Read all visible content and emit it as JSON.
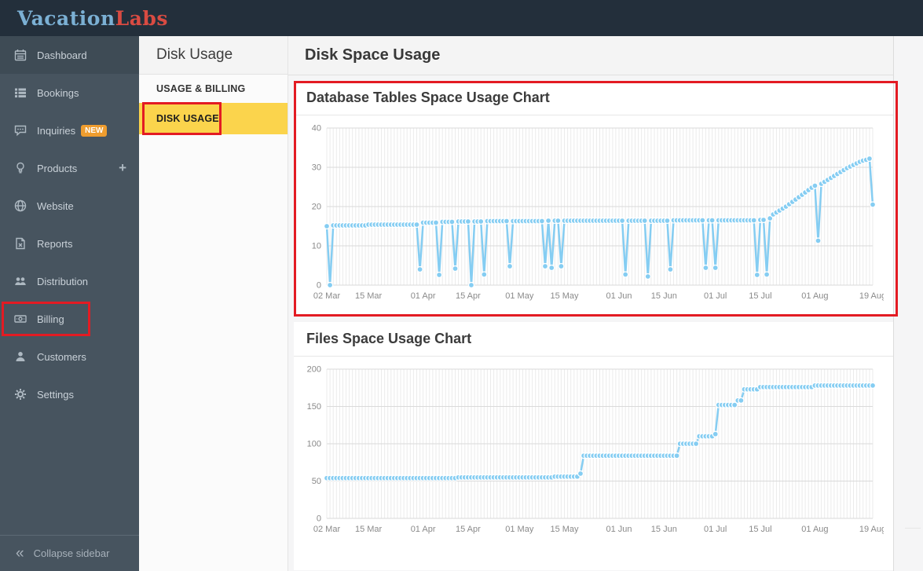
{
  "topbar": {
    "logo_part1": "Vacation",
    "logo_part2": "Labs"
  },
  "sidebar": {
    "items": [
      {
        "label": "Dashboard",
        "icon": "calendar-icon",
        "active": true
      },
      {
        "label": "Bookings",
        "icon": "list-icon",
        "active": false
      },
      {
        "label": "Inquiries",
        "icon": "comment-icon",
        "active": false,
        "badge": "NEW"
      },
      {
        "label": "Products",
        "icon": "lightbulb-icon",
        "active": false,
        "action": "+"
      },
      {
        "label": "Website",
        "icon": "globe-icon",
        "active": false
      },
      {
        "label": "Reports",
        "icon": "file-excel-icon",
        "active": false
      },
      {
        "label": "Distribution",
        "icon": "users-icon",
        "active": false
      },
      {
        "label": "Billing",
        "icon": "money-icon",
        "active": false,
        "annotated": true
      },
      {
        "label": "Customers",
        "icon": "user-icon",
        "active": false
      },
      {
        "label": "Settings",
        "icon": "gear-icon",
        "active": false
      }
    ],
    "collapse_label": "Collapse sidebar"
  },
  "subnav": {
    "title": "Disk Usage",
    "items": [
      "USAGE & BILLING",
      "DISK USAGE"
    ],
    "active_item": "DISK USAGE"
  },
  "main": {
    "title": "Disk Space Usage"
  },
  "colors": {
    "topbar": "#232f3b",
    "sidebar": "#47545f",
    "sidebar_active": "#3e4b55",
    "accent_yellow": "#fbd44c",
    "badge_orange": "#ef9d2f",
    "annotation_red": "#e31b23",
    "chart_line_blue": "#85cdf2",
    "logo_blue": "#7bb0d4",
    "logo_red": "#d94b42"
  },
  "annotations": {
    "color": "#e31b23",
    "targets": [
      "billing-nav-item",
      "disk-usage-subnav-item",
      "database-chart-card"
    ]
  },
  "chart_data": [
    {
      "type": "line",
      "title": "Database Tables Space Usage Chart",
      "xlabel": "",
      "ylabel": "",
      "x_unit": "day",
      "x_range": [
        "02 Mar",
        "19 Aug"
      ],
      "ylim": [
        0,
        40
      ],
      "yticks": [
        0,
        10,
        20,
        30,
        40
      ],
      "xticks": [
        {
          "i": 0,
          "label": "02 Mar"
        },
        {
          "i": 13,
          "label": "15 Mar"
        },
        {
          "i": 30,
          "label": "01 Apr"
        },
        {
          "i": 44,
          "label": "15 Apr"
        },
        {
          "i": 60,
          "label": "01 May"
        },
        {
          "i": 74,
          "label": "15 May"
        },
        {
          "i": 91,
          "label": "01 Jun"
        },
        {
          "i": 105,
          "label": "15 Jun"
        },
        {
          "i": 121,
          "label": "01 Jul"
        },
        {
          "i": 135,
          "label": "15 Jul"
        },
        {
          "i": 152,
          "label": "01 Aug"
        },
        {
          "i": 170,
          "label": "19 Aug"
        }
      ],
      "grid": true,
      "legend": "none",
      "color": "#85cdf2",
      "values": [
        15,
        0,
        15.2,
        15.2,
        15.2,
        15.2,
        15.2,
        15.2,
        15.2,
        15.2,
        15.2,
        15.2,
        15.2,
        15.4,
        15.4,
        15.4,
        15.4,
        15.4,
        15.4,
        15.4,
        15.4,
        15.4,
        15.4,
        15.4,
        15.4,
        15.4,
        15.4,
        15.4,
        15.4,
        4,
        15.9,
        15.9,
        15.9,
        15.9,
        15.9,
        2.6,
        16.1,
        16.1,
        16.1,
        16.1,
        4.2,
        16.2,
        16.2,
        16.2,
        16.2,
        0,
        16.2,
        16.2,
        16.2,
        2.7,
        16.3,
        16.3,
        16.3,
        16.3,
        16.3,
        16.3,
        16.3,
        4.8,
        16.3,
        16.3,
        16.3,
        16.3,
        16.3,
        16.3,
        16.3,
        16.3,
        16.3,
        16.3,
        4.8,
        16.4,
        4.4,
        16.4,
        16.4,
        4.8,
        16.4,
        16.4,
        16.4,
        16.4,
        16.4,
        16.4,
        16.4,
        16.4,
        16.4,
        16.4,
        16.4,
        16.4,
        16.4,
        16.4,
        16.4,
        16.4,
        16.4,
        16.4,
        16.4,
        2.7,
        16.4,
        16.4,
        16.4,
        16.4,
        16.4,
        16.4,
        2.2,
        16.4,
        16.4,
        16.4,
        16.4,
        16.4,
        16.4,
        4,
        16.5,
        16.5,
        16.5,
        16.5,
        16.5,
        16.5,
        16.5,
        16.5,
        16.5,
        16.5,
        4.4,
        16.5,
        16.5,
        4.4,
        16.5,
        16.5,
        16.5,
        16.5,
        16.5,
        16.5,
        16.5,
        16.5,
        16.5,
        16.5,
        16.5,
        16.5,
        2.6,
        16.6,
        16.6,
        2.7,
        17,
        18,
        18.5,
        19,
        19.5,
        20,
        20.6,
        21.2,
        21.8,
        22.4,
        23,
        23.6,
        24.2,
        24.8,
        25.3,
        11.3,
        25.8,
        26.3,
        26.8,
        27.3,
        27.8,
        28.3,
        28.8,
        29.3,
        29.8,
        30.2,
        30.6,
        31,
        31.4,
        31.7,
        31.9,
        32.2,
        20.5
      ]
    },
    {
      "type": "line",
      "title": "Files Space Usage Chart",
      "xlabel": "",
      "ylabel": "",
      "x_unit": "day",
      "x_range": [
        "02 Mar",
        "19 Aug"
      ],
      "ylim": [
        0,
        200
      ],
      "yticks": [
        0,
        50,
        100,
        150,
        200
      ],
      "xticks": [
        {
          "i": 0,
          "label": "02 Mar"
        },
        {
          "i": 13,
          "label": "15 Mar"
        },
        {
          "i": 30,
          "label": "01 Apr"
        },
        {
          "i": 44,
          "label": "15 Apr"
        },
        {
          "i": 60,
          "label": "01 May"
        },
        {
          "i": 74,
          "label": "15 May"
        },
        {
          "i": 91,
          "label": "01 Jun"
        },
        {
          "i": 105,
          "label": "15 Jun"
        },
        {
          "i": 121,
          "label": "01 Jul"
        },
        {
          "i": 135,
          "label": "15 Jul"
        },
        {
          "i": 152,
          "label": "01 Aug"
        },
        {
          "i": 170,
          "label": "19 Aug"
        }
      ],
      "grid": true,
      "legend": "none",
      "color": "#85cdf2",
      "values": [
        54,
        54,
        54,
        54,
        54,
        54,
        54,
        54,
        54,
        54,
        54,
        54,
        54,
        54,
        54,
        54,
        54,
        54,
        54,
        54,
        54,
        54,
        54,
        54,
        54,
        54,
        54,
        54,
        54,
        54,
        54,
        54,
        54,
        54,
        54,
        54,
        54,
        54,
        54,
        54,
        54,
        55,
        55,
        55,
        55,
        55,
        55,
        55,
        55,
        55,
        55,
        55,
        55,
        55,
        55,
        55,
        55,
        55,
        55,
        55,
        55,
        55,
        55,
        55,
        55,
        55,
        55,
        55,
        55,
        55,
        55,
        56,
        56,
        56,
        56,
        56,
        56,
        56,
        56,
        60,
        84,
        84,
        84,
        84,
        84,
        84,
        84,
        84,
        84,
        84,
        84,
        84,
        84,
        84,
        84,
        84,
        84,
        84,
        84,
        84,
        84,
        84,
        84,
        84,
        84,
        84,
        84,
        84,
        84,
        84,
        100,
        100,
        100,
        100,
        100,
        100,
        110,
        110,
        110,
        110,
        110,
        113,
        152,
        152,
        152,
        152,
        152,
        152,
        158,
        158,
        173,
        173,
        173,
        173,
        173,
        176,
        176,
        176,
        176,
        176,
        176,
        176,
        176,
        176,
        176,
        176,
        176,
        176,
        176,
        176,
        176,
        176,
        178,
        178,
        178,
        178,
        178,
        178,
        178,
        178,
        178,
        178,
        178,
        178,
        178,
        178,
        178,
        178,
        178,
        178,
        178
      ]
    }
  ]
}
